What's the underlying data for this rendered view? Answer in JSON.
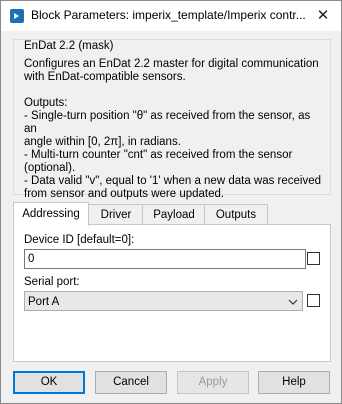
{
  "window": {
    "title": "Block Parameters: imperix_template/Imperix contr..."
  },
  "mask": {
    "group_label": "EnDat 2.2 (mask)",
    "description": "Configures an EnDat 2.2 master for digital communication with EnDat-compatible sensors.",
    "outputs_heading": "Outputs:",
    "outputs": [
      "- Single-turn position \"θ\" as received from the sensor, as an",
      "angle within [0, 2π], in radians.",
      "- Multi-turn counter \"cnt\" as received from the sensor",
      "(optional).",
      "- Data valid \"v\", equal to '1' when a new data was received",
      "from sensor and outputs were updated."
    ]
  },
  "tabs": [
    "Addressing",
    "Driver",
    "Payload",
    "Outputs"
  ],
  "active_tab": "Addressing",
  "addressing": {
    "device_id_label": "Device ID [default=0]:",
    "device_id_value": "0",
    "serial_port_label": "Serial port:",
    "serial_port_value": "Port A"
  },
  "buttons": {
    "ok": "OK",
    "cancel": "Cancel",
    "apply": "Apply",
    "help": "Help"
  },
  "icons": {
    "app": "simulink-block-icon",
    "close": "close-icon",
    "dropdown": "chevron-down-icon"
  },
  "colors": {
    "accent": "#0078d7",
    "app_icon": "#1c6fb5"
  }
}
